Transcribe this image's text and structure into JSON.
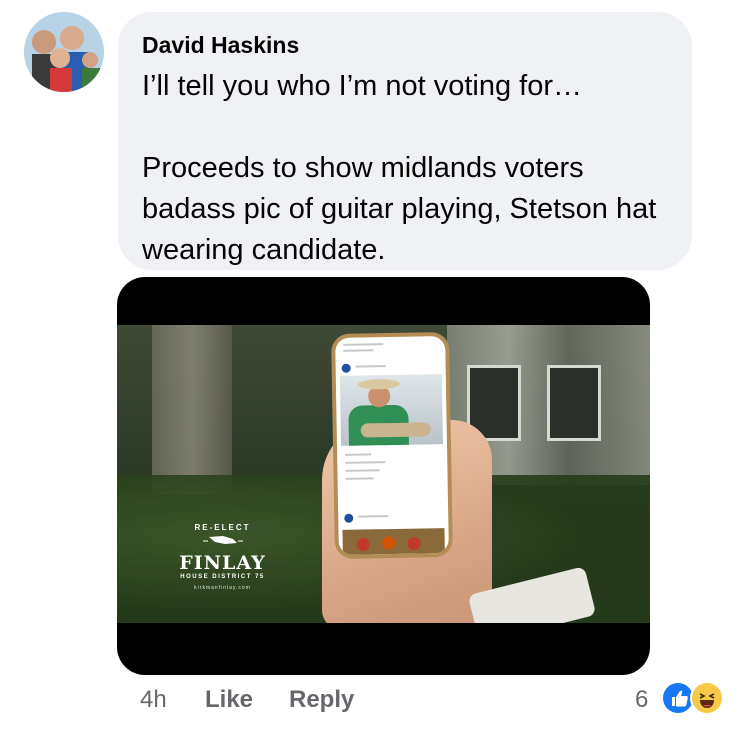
{
  "comment": {
    "author": "David Haskins",
    "text": "I’ll tell you who I’m not voting for…\n\nProceeds to show midlands voters badass pic of guitar playing, Stetson hat wearing candidate."
  },
  "media": {
    "logo_top": "RE-ELECT",
    "logo_name": "FINLAY",
    "logo_district": "HOUSE DISTRICT 75",
    "logo_url": "kirkmanfinlay.com"
  },
  "footer": {
    "time": "4h",
    "like_label": "Like",
    "reply_label": "Reply",
    "reaction_count": "6"
  },
  "icons": {
    "like_reaction": "thumbs-up-icon",
    "haha_reaction": "laughing-face-icon",
    "reaction_colors": {
      "like": "#1877f2",
      "haha": "#f7c948"
    }
  }
}
